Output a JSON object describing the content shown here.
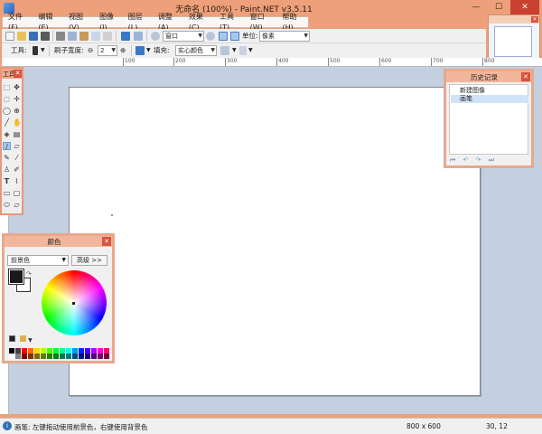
{
  "window": {
    "title": "无命名 (100%) - Paint.NET v3.5.11",
    "min": "—",
    "max": "☐",
    "close": "✕"
  },
  "menu": [
    "文件(F)",
    "编辑(E)",
    "视图(V)",
    "图像(I)",
    "图层(L)",
    "调整(A)",
    "效果(C)",
    "工具(T)",
    "窗口(W)",
    "帮助(H)"
  ],
  "toolbar": {
    "zoom_value": "窗口",
    "units_label": "单位:",
    "units_value": "像素",
    "tool_label": "工具:",
    "brush_label": "刷子宽度:",
    "brush_value": "2",
    "fill_label": "填充:",
    "fill_value": "实心颜色"
  },
  "ruler": [
    "100",
    "200",
    "300",
    "400",
    "500",
    "600",
    "700",
    "800"
  ],
  "tools": {
    "title": "工具",
    "close": "✕",
    "icons": [
      "selection-icon",
      "move-icon",
      "lasso-icon",
      "move-selection-icon",
      "ellipse-select-icon",
      "zoom-icon",
      "magic-wand-icon",
      "pan-icon",
      "paint-bucket-icon",
      "gradient-icon",
      "paintbrush-icon",
      "eraser-icon",
      "pencil-icon",
      "color-picker-icon",
      "clone-stamp-icon",
      "recolor-icon",
      "text-icon",
      "line-icon",
      "rectangle-icon",
      "rounded-rectangle-icon",
      "ellipse-icon",
      "freeform-icon"
    ]
  },
  "colors": {
    "title": "颜色",
    "close": "✕",
    "primary_select": "前景色",
    "more_button": "高级 >>",
    "primary": "#1a1a1a",
    "secondary": "#ffffff",
    "palette": [
      "#000000",
      "#404040",
      "#ff0000",
      "#ff6a00",
      "#ffd800",
      "#b6ff00",
      "#4cff00",
      "#00ff21",
      "#00ff90",
      "#00ffff",
      "#0094ff",
      "#0026ff",
      "#4800ff",
      "#b200ff",
      "#ff00dc",
      "#ff006e",
      "#ffffff",
      "#808080",
      "#7f0000",
      "#7f3300",
      "#7f6a00",
      "#5b7f00",
      "#267f00",
      "#007f0e",
      "#007f46",
      "#007f7f",
      "#004a7f",
      "#00137f",
      "#21007f",
      "#57007f",
      "#7f006e",
      "#7f0037"
    ]
  },
  "history": {
    "title": "历史记录",
    "close": "✕",
    "items": [
      "新建图像",
      "画笔"
    ],
    "nav": "⏮ ↶ ↷ ⏭"
  },
  "status": {
    "text": "画笔: 左键拖动使用前景色，右键使用背景色",
    "size": "800 x 600",
    "position": "30, 12"
  },
  "accent_color": "#eda07a"
}
